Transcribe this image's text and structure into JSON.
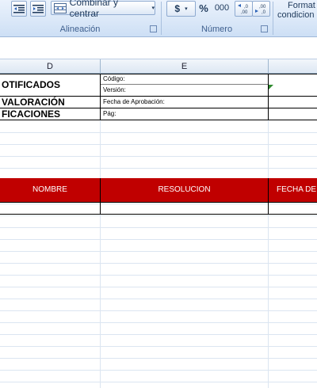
{
  "ribbon": {
    "alignment": {
      "merge_center_label": "Combinar y centrar",
      "group_label": "Alineación"
    },
    "number": {
      "currency_symbol": "$",
      "percent_symbol": "%",
      "thousands_label": "000",
      "group_label": "Número"
    },
    "styles": {
      "format_label_1": "Format",
      "format_label_2": "condicion"
    }
  },
  "columns": [
    "D",
    "E"
  ],
  "form_header": {
    "title_line1": "OTIFICADOS",
    "title_line2": "VALORACIÓN",
    "title_line3": "FICACIONES",
    "code_label": "Código:",
    "version_label": "Versión:",
    "approval_date_label": "Fecha de Aprobación:",
    "page_label": "Pág:"
  },
  "table_header": {
    "col_name": "NOMBRE",
    "col_resolution": "RESOLUCION",
    "col_date": "FECHA DE N"
  },
  "colors": {
    "header_red": "#c00000",
    "ribbon_blue": "#dbe8f8",
    "grid_line": "#dbe5f1"
  }
}
